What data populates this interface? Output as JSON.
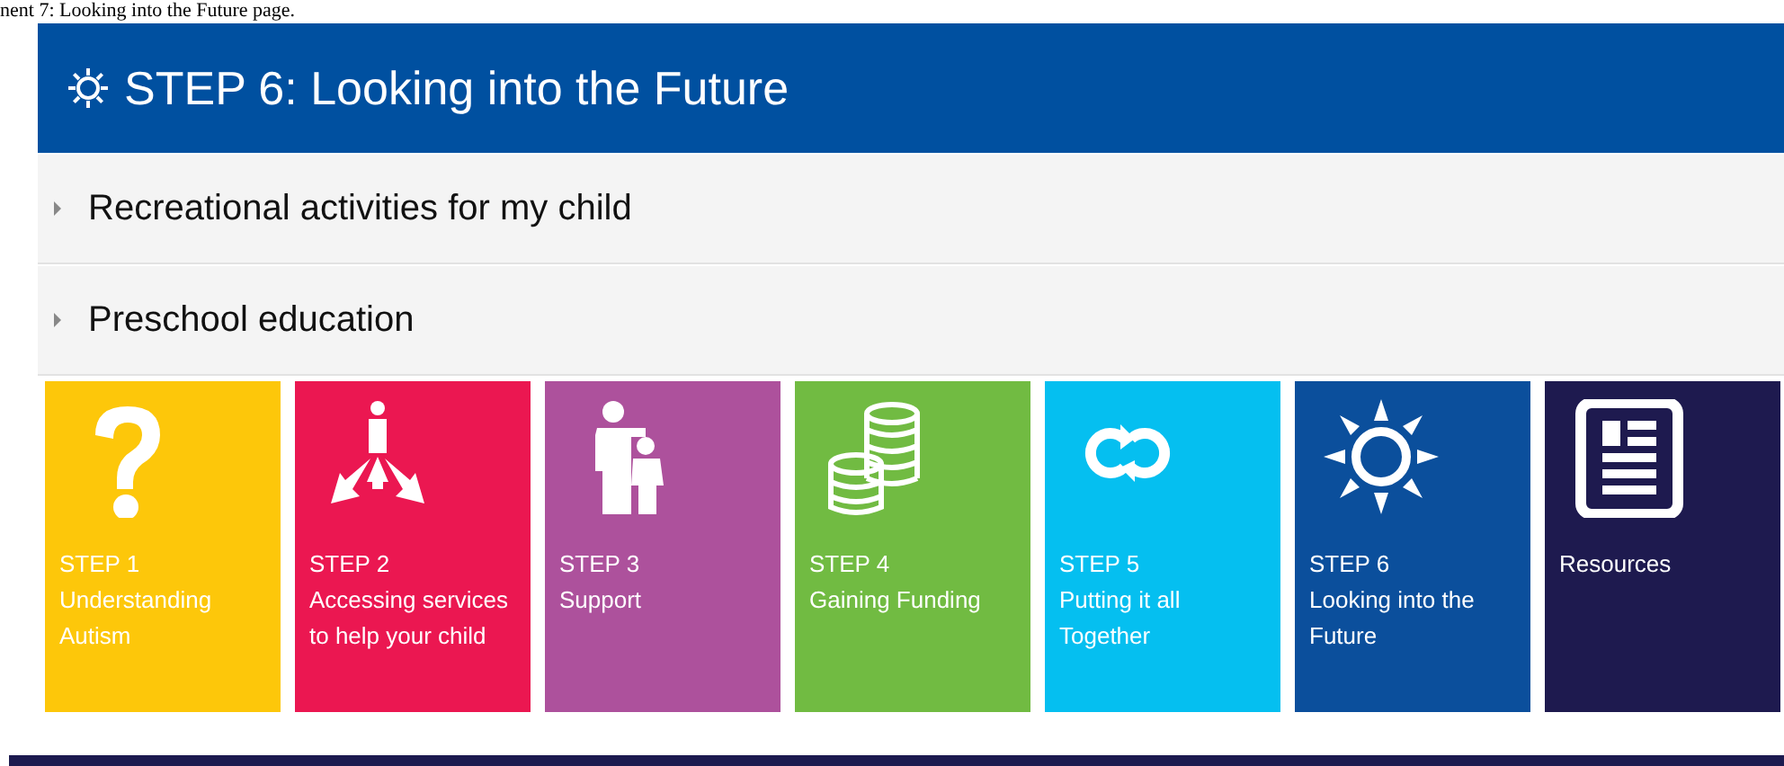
{
  "caption": "nent 7: Looking into the Future page.",
  "header": {
    "title": "STEP 6: Looking into the Future"
  },
  "accordion": [
    {
      "label": "Recreational activities for my child",
      "expanded": false
    },
    {
      "label": "Preschool education",
      "expanded": false
    }
  ],
  "tiles": [
    {
      "kind": "question",
      "step": "STEP 1",
      "title": "Understanding Autism",
      "color": "#fdc70a"
    },
    {
      "kind": "arrows",
      "step": "STEP 2",
      "title": "Accessing services to help your child",
      "color": "#eb1751"
    },
    {
      "kind": "people",
      "step": "STEP 3",
      "title": "Support",
      "color": "#ad519c"
    },
    {
      "kind": "coins",
      "step": "STEP 4",
      "title": "Gaining Funding",
      "color": "#71bb42"
    },
    {
      "kind": "cycle",
      "step": "STEP 5",
      "title": "Putting it all Together",
      "color": "#05bff0"
    },
    {
      "kind": "sun",
      "step": "STEP 6",
      "title": "Looking into the Future",
      "color": "#0b4f9c"
    },
    {
      "kind": "document",
      "title": "Resources",
      "color": "#1e1a4f"
    }
  ]
}
